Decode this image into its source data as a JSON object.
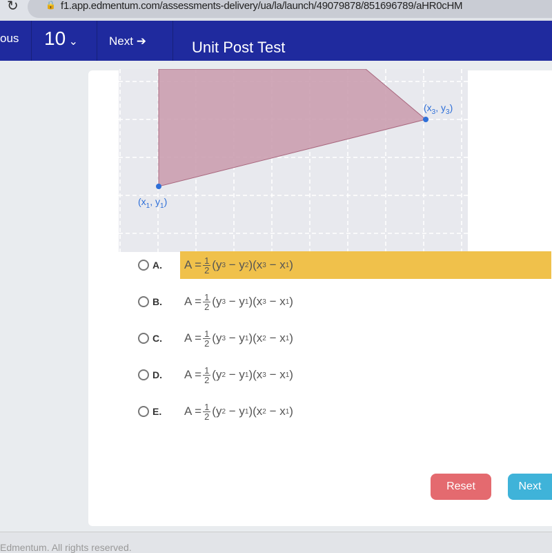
{
  "browser": {
    "url": "f1.app.edmentum.com/assessments-delivery/ua/la/launch/49079878/851696789/aHR0cHM"
  },
  "nav": {
    "previous_label": "ous",
    "question_number": "10",
    "next_label": "Next",
    "title": "Unit Post Test"
  },
  "graph": {
    "point1_label": {
      "v": "x",
      "i": "1",
      "w": "y",
      "j": "1"
    },
    "point3_label": {
      "v": "x",
      "i": "3",
      "w": "y",
      "j": "3"
    },
    "fill_color": "#c99aab",
    "point_color": "#2e6fd8"
  },
  "options": [
    {
      "letter": "A.",
      "lhs": "A =",
      "num": "1",
      "den": "2",
      "a": "y",
      "ai": "3",
      "b": "y",
      "bi": "2",
      "c": "x",
      "ci": "3",
      "d": "x",
      "di": "1",
      "highlighted": true
    },
    {
      "letter": "B.",
      "lhs": "A =",
      "num": "1",
      "den": "2",
      "a": "y",
      "ai": "3",
      "b": "y",
      "bi": "1",
      "c": "x",
      "ci": "3",
      "d": "x",
      "di": "1"
    },
    {
      "letter": "C.",
      "lhs": "A =",
      "num": "1",
      "den": "2",
      "a": "y",
      "ai": "3",
      "b": "y",
      "bi": "1",
      "c": "x",
      "ci": "2",
      "d": "x",
      "di": "1"
    },
    {
      "letter": "D.",
      "lhs": "A =",
      "num": "1",
      "den": "2",
      "a": "y",
      "ai": "2",
      "b": "y",
      "bi": "1",
      "c": "x",
      "ci": "3",
      "d": "x",
      "di": "1"
    },
    {
      "letter": "E.",
      "lhs": "A =",
      "num": "1",
      "den": "2",
      "a": "y",
      "ai": "2",
      "b": "y",
      "bi": "1",
      "c": "x",
      "ci": "2",
      "d": "x",
      "di": "1"
    }
  ],
  "buttons": {
    "reset": "Reset",
    "next": "Next"
  },
  "footer": "Edmentum. All rights reserved."
}
